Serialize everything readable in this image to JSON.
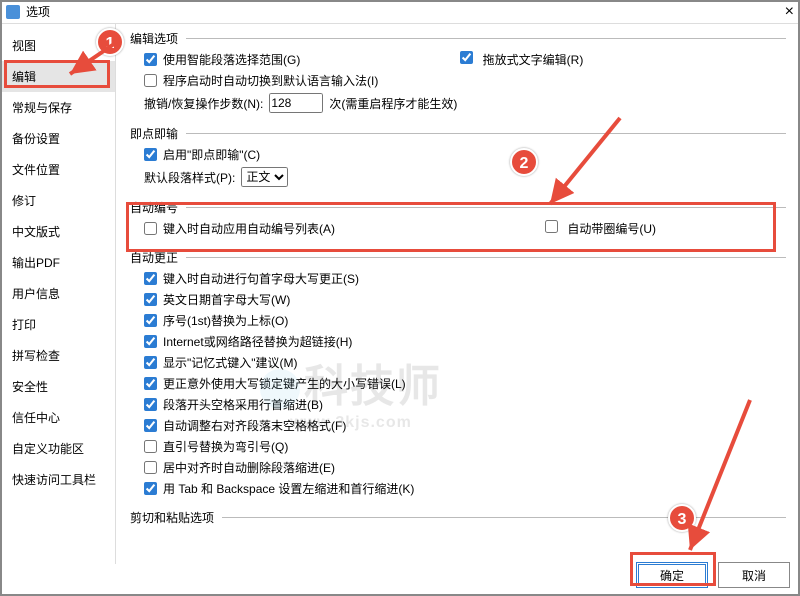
{
  "window": {
    "title": "选项"
  },
  "sidebar": {
    "items": [
      {
        "label": "视图"
      },
      {
        "label": "编辑"
      },
      {
        "label": "常规与保存"
      },
      {
        "label": "备份设置"
      },
      {
        "label": "文件位置"
      },
      {
        "label": "修订"
      },
      {
        "label": "中文版式"
      },
      {
        "label": "输出PDF"
      },
      {
        "label": "用户信息"
      },
      {
        "label": "打印"
      },
      {
        "label": "拼写检查"
      },
      {
        "label": "安全性"
      },
      {
        "label": "信任中心"
      },
      {
        "label": "自定义功能区"
      },
      {
        "label": "快速访问工具栏"
      }
    ],
    "active_index": 1
  },
  "groups": {
    "edit_options": {
      "legend": "编辑选项",
      "smart_para": "使用智能段落选择范围(G)",
      "drag_text": "拖放式文字编辑(R)",
      "auto_ime": "程序启动时自动切换到默认语言输入法(I)",
      "undo_label": "撤销/恢复操作步数(N):",
      "undo_value": 128,
      "undo_suffix": "次(需重启程序才能生效)"
    },
    "click_type": {
      "legend": "即点即输",
      "enable": "启用\"即点即输\"(C)",
      "para_style_label": "默认段落样式(P):",
      "para_style_value": "正文"
    },
    "auto_number": {
      "legend": "自动编号",
      "apply_list": "键入时自动应用自动编号列表(A)",
      "circle_num": "自动带圈编号(U)"
    },
    "auto_correct": {
      "legend": "自动更正",
      "items": [
        {
          "label": "键入时自动进行句首字母大写更正(S)",
          "chk": true
        },
        {
          "label": "英文日期首字母大写(W)",
          "chk": true
        },
        {
          "label": "序号(1st)替换为上标(O)",
          "chk": true
        },
        {
          "label": "Internet或网络路径替换为超链接(H)",
          "chk": true
        },
        {
          "label": "显示\"记忆式键入\"建议(M)",
          "chk": true
        },
        {
          "label": "更正意外使用大写锁定键产生的大小写错误(L)",
          "chk": true
        },
        {
          "label": "段落开头空格采用行首缩进(B)",
          "chk": true
        },
        {
          "label": "自动调整右对齐段落末空格格式(F)",
          "chk": true
        },
        {
          "label": "直引号替换为弯引号(Q)",
          "chk": false
        },
        {
          "label": "居中对齐时自动删除段落缩进(E)",
          "chk": false
        },
        {
          "label": "用 Tab 和 Backspace 设置左缩进和首行缩进(K)",
          "chk": true
        }
      ]
    },
    "cut_paste": {
      "legend": "剪切和粘贴选项"
    }
  },
  "buttons": {
    "ok": "确定",
    "cancel": "取消"
  },
  "annotations": {
    "n1": "1",
    "n2": "2",
    "n3": "3"
  },
  "watermark": {
    "main": "科技师",
    "sub": "www.3kjs.com"
  }
}
